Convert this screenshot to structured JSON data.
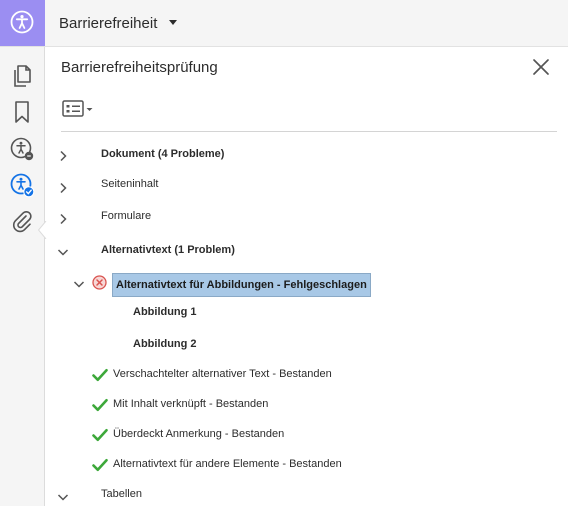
{
  "header": {
    "title": "Barrierefreiheit",
    "app_icon": "accessibility-icon",
    "accent_color": "#9b8ef2"
  },
  "rail": {
    "items": [
      {
        "name": "pages-icon"
      },
      {
        "name": "bookmark-icon"
      },
      {
        "name": "accessibility-reading-icon"
      },
      {
        "name": "accessibility-check-icon",
        "active": true
      },
      {
        "name": "attachment-icon"
      }
    ]
  },
  "panel": {
    "title": "Barrierefreiheitsprüfung",
    "close_icon": "close-icon",
    "options_icon": "options-menu-icon"
  },
  "tree": {
    "document": "Dokument (4 Probleme)",
    "page_content": "Seiteninhalt",
    "forms": "Formulare",
    "alt_text": "Alternativtext (1 Problem)",
    "figures_alt_text": "Alternativtext für Abbildungen - Fehlgeschlagen",
    "figure1": "Abbildung 1",
    "figure2": "Abbildung 2",
    "nested_alt": "Verschachtelter alternativer Text - Bestanden",
    "associated": "Mit Inhalt verknüpft - Bestanden",
    "hides_annotation": "Überdeckt Anmerkung - Bestanden",
    "other_elements": "Alternativtext für andere Elemente - Bestanden",
    "tables": "Tabellen"
  },
  "colors": {
    "selection": "#a8c8e6",
    "pass": "#3da83a",
    "fail": "#d9534f",
    "active_icon": "#1473e6"
  }
}
